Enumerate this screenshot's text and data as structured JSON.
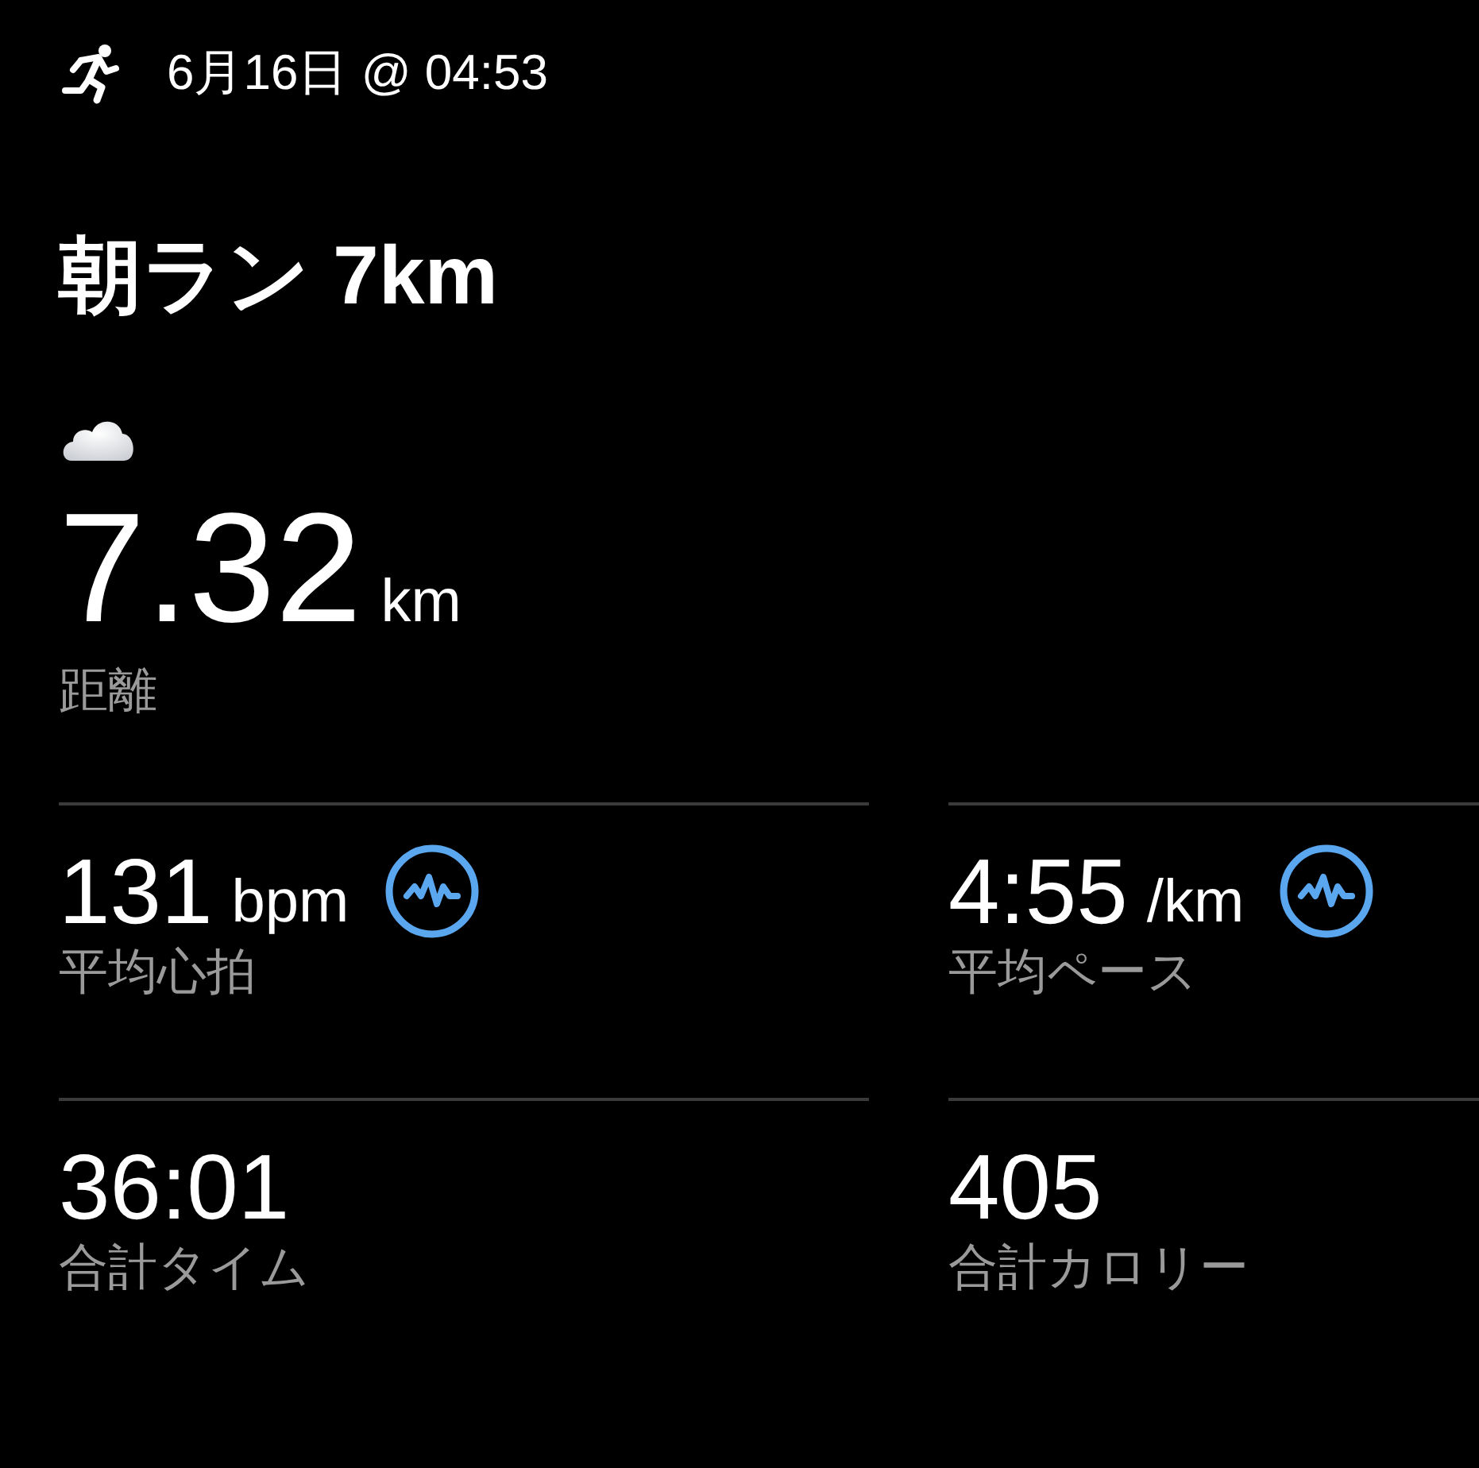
{
  "header": {
    "date": "6月16日 @ 04:53"
  },
  "title": "朝ラン 7km",
  "distance": {
    "value": "7.32",
    "unit": "km",
    "label": "距離"
  },
  "stats": [
    {
      "value": "131",
      "unit": "bpm",
      "label": "平均心拍",
      "heart_rate_icon": true
    },
    {
      "value": "4:55",
      "unit": "/km",
      "label": "平均ペース",
      "heart_rate_icon": true
    },
    {
      "value": "36:01",
      "label": "合計タイム",
      "heart_rate_icon": false
    },
    {
      "value": "405",
      "label": "合計カロリー",
      "heart_rate_icon": false
    }
  ]
}
